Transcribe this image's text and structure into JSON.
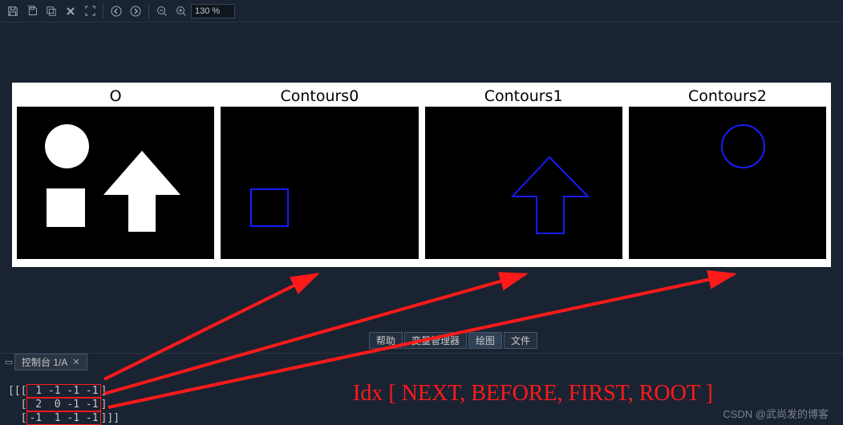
{
  "toolbar": {
    "zoom_value": "130 %"
  },
  "subplots": {
    "t0": "O",
    "t1": "Contours0",
    "t2": "Contours1",
    "t3": "Contours2"
  },
  "content_tabs": {
    "help": "帮助",
    "varmgr": "变量管理器",
    "plot": "绘图",
    "file": "文件"
  },
  "console": {
    "tab_label": "控制台 1/A",
    "rows": {
      "prefix0": "[[[",
      "r0": " 1 -1 -1 -1",
      "prefix1": "  [",
      "r1": " 2  0 -1 -1",
      "prefix2": "  [",
      "r2": "-1  1 -1 -1",
      "suffix": "]]]"
    }
  },
  "annotation": {
    "label": "Idx   [ NEXT, BEFORE, FIRST, ROOT ]"
  },
  "watermark": "CSDN @武尚发的博客"
}
